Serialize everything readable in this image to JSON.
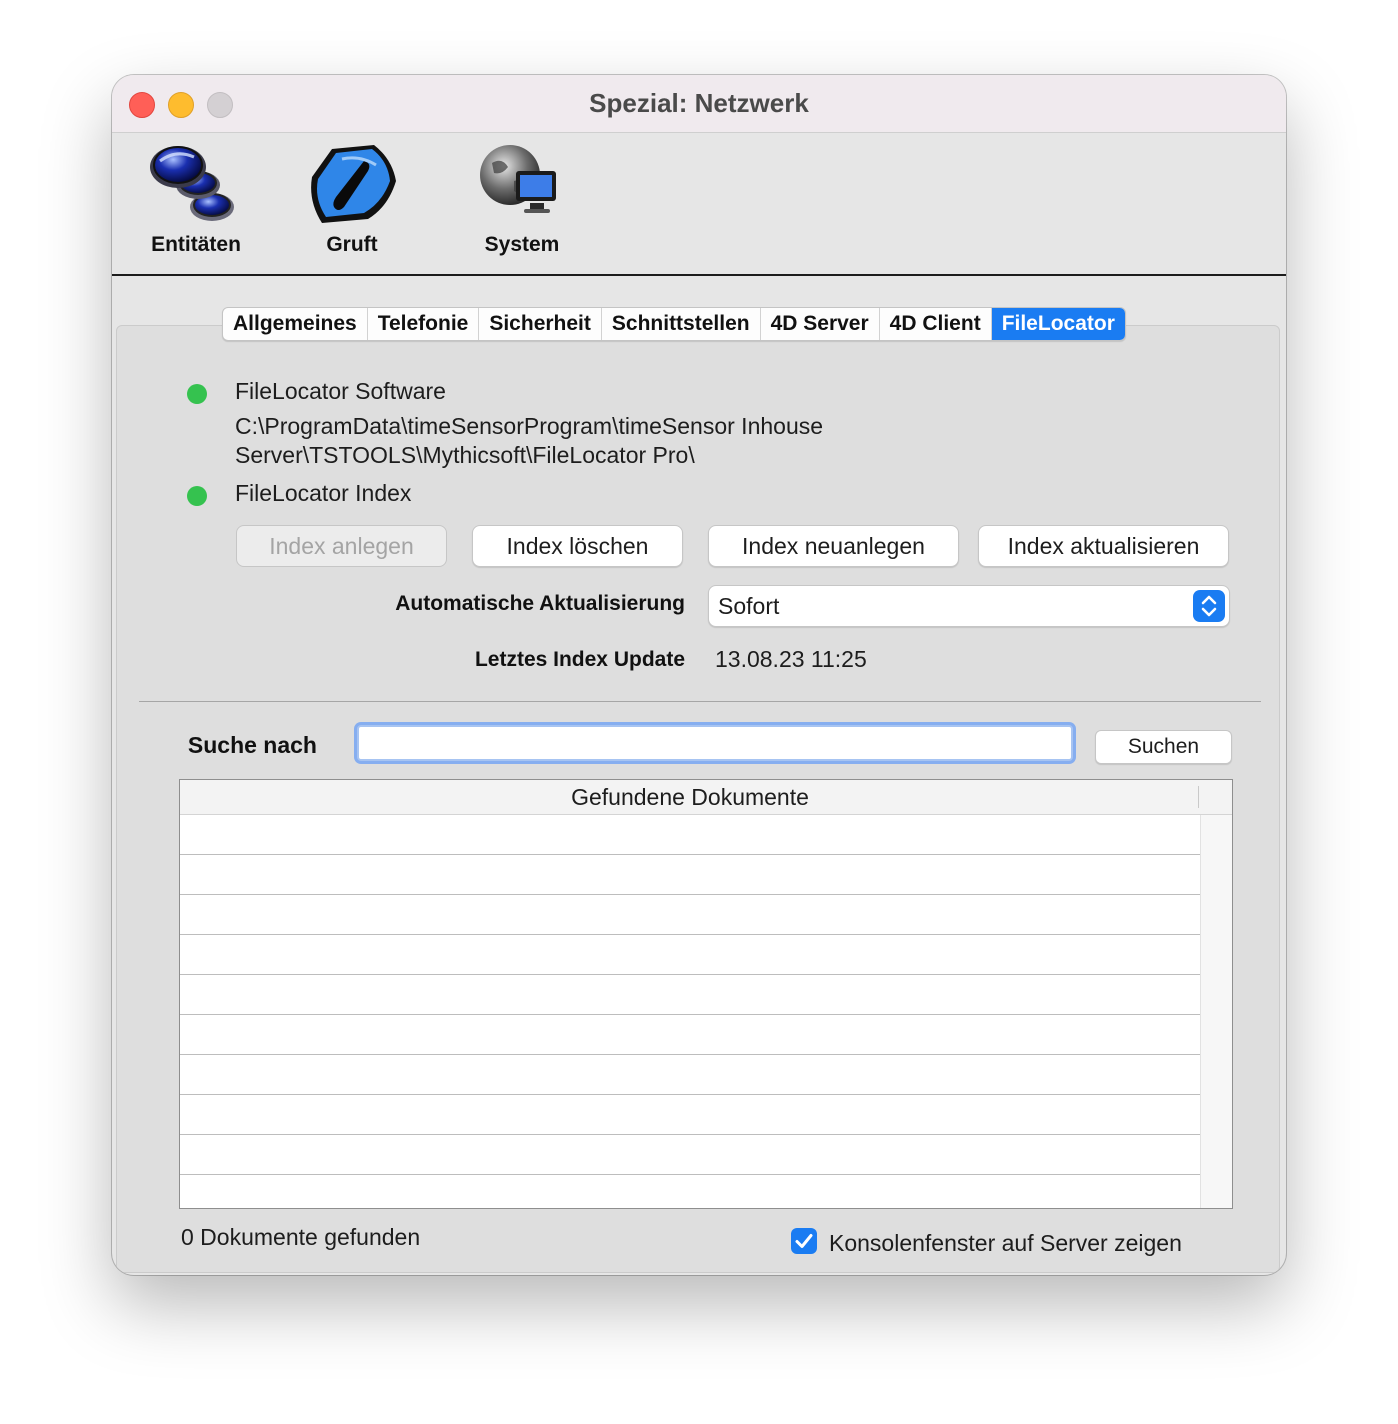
{
  "window": {
    "title": "Spezial: Netzwerk"
  },
  "toolbar": {
    "items": [
      {
        "label": "Entitäten",
        "icon": "entities-icon"
      },
      {
        "label": "Gruft",
        "icon": "vault-icon"
      },
      {
        "label": "System",
        "icon": "system-icon"
      }
    ]
  },
  "tabs": [
    {
      "label": "Allgemeines"
    },
    {
      "label": "Telefonie"
    },
    {
      "label": "Sicherheit"
    },
    {
      "label": "Schnittstellen"
    },
    {
      "label": "4D Server"
    },
    {
      "label": "4D Client"
    },
    {
      "label": "FileLocator",
      "active": true
    }
  ],
  "filelocator": {
    "software_label": "FileLocator Software",
    "software_path_line1": "C:\\ProgramData\\timeSensorProgram\\timeSensor Inhouse",
    "software_path_line2": "Server\\TSTOOLS\\Mythicsoft\\FileLocator Pro\\",
    "index_label": "FileLocator Index",
    "status_color": "#35c24f",
    "buttons": {
      "create": "Index anlegen",
      "delete": "Index löschen",
      "recreate": "Index neuanlegen",
      "update": "Index aktualisieren"
    },
    "auto_update_label": "Automatische Aktualisierung",
    "auto_update_value": "Sofort",
    "last_update_label": "Letztes Index Update",
    "last_update_value": "13.08.23 11:25"
  },
  "search": {
    "label": "Suche nach",
    "value": "",
    "button": "Suchen"
  },
  "results": {
    "column_header": "Gefundene Dokumente",
    "rows": [
      "",
      "",
      "",
      "",
      "",
      "",
      "",
      "",
      "",
      ""
    ],
    "status": "0 Dokumente gefunden"
  },
  "console": {
    "label": "Konsolenfenster auf Server zeigen",
    "checked": true
  },
  "colors": {
    "accent": "#1a7cf2",
    "status_ok": "#35c24f"
  }
}
